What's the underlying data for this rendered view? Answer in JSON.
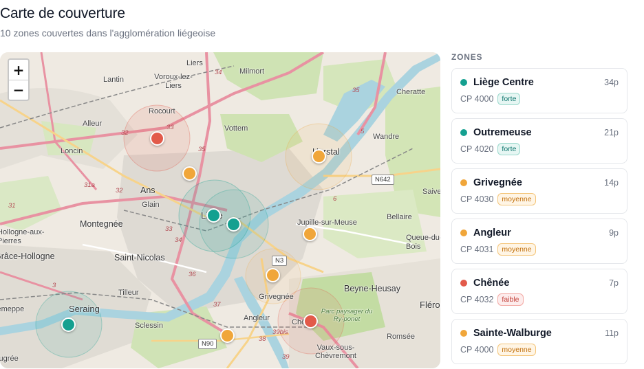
{
  "header": {
    "title": "Carte de couverture",
    "subtitle": "10 zones couvertes dans l'agglomération liégeoise"
  },
  "map": {
    "zoom_in": "+",
    "zoom_out": "−",
    "places": [
      "Liers",
      "Milmort",
      "Lantin",
      "Voroux-lez-Liers",
      "Cheratte",
      "Rocourt",
      "Alleur",
      "Vottem",
      "Wandre",
      "Loncin",
      "Herstal",
      "Ans",
      "Glain",
      "Montegnée",
      "Liège",
      "Jupille-sur-Meuse",
      "Bellaire",
      "Saive",
      "Queue-du-Bois",
      "Grâce-Hollogne",
      "Hollogne-aux-Pierres",
      "Saint-Nicolas",
      "Tilleur",
      "Beyne-Heusay",
      "Seraing",
      "Fléron",
      "Grivegnée",
      "Sclessin",
      "Angleur",
      "Chênée",
      "Romsée",
      "Jemeppe",
      "Vaux-sous-Chèvremont",
      "Ougrée",
      "Parc paysager du Ry-ponet"
    ],
    "roads": [
      "34",
      "35",
      "32",
      "33",
      "31a",
      "31",
      "3",
      "36",
      "37",
      "38",
      "39",
      "39bis",
      "5",
      "6"
    ],
    "shields": [
      "N642",
      "N3",
      "N90"
    ],
    "marker_colors": {
      "forte": "#14a090",
      "moyenne": "#f0a63a",
      "faible": "#e25a4a"
    },
    "markers": [
      {
        "zone": "Liège Centre",
        "level": "forte"
      },
      {
        "zone": "Outremeuse",
        "level": "forte"
      },
      {
        "zone": "Seraing",
        "level": "forte"
      },
      {
        "zone": "Grivegnée",
        "level": "moyenne"
      },
      {
        "zone": "Angleur",
        "level": "moyenne"
      },
      {
        "zone": "Herstal",
        "level": "moyenne"
      },
      {
        "zone": "Ans",
        "level": "moyenne"
      },
      {
        "zone": "Jupille",
        "level": "moyenne"
      },
      {
        "zone": "Sclessin",
        "level": "moyenne"
      },
      {
        "zone": "Rocourt",
        "level": "faible"
      },
      {
        "zone": "Chênée",
        "level": "faible"
      }
    ]
  },
  "sidebar": {
    "heading": "ZONES",
    "zones": [
      {
        "name": "Liège Centre",
        "cp": "CP 4000",
        "count": "34p",
        "level": "forte",
        "color": "#14a090"
      },
      {
        "name": "Outremeuse",
        "cp": "CP 4020",
        "count": "21p",
        "level": "forte",
        "color": "#14a090"
      },
      {
        "name": "Grivegnée",
        "cp": "CP 4030",
        "count": "14p",
        "level": "moyenne",
        "color": "#f0a63a"
      },
      {
        "name": "Angleur",
        "cp": "CP 4031",
        "count": "9p",
        "level": "moyenne",
        "color": "#f0a63a"
      },
      {
        "name": "Chênée",
        "cp": "CP 4032",
        "count": "7p",
        "level": "faible",
        "color": "#e25a4a"
      },
      {
        "name": "Sainte-Walburge",
        "cp": "CP 4000",
        "count": "11p",
        "level": "moyenne",
        "color": "#f0a63a"
      }
    ]
  }
}
